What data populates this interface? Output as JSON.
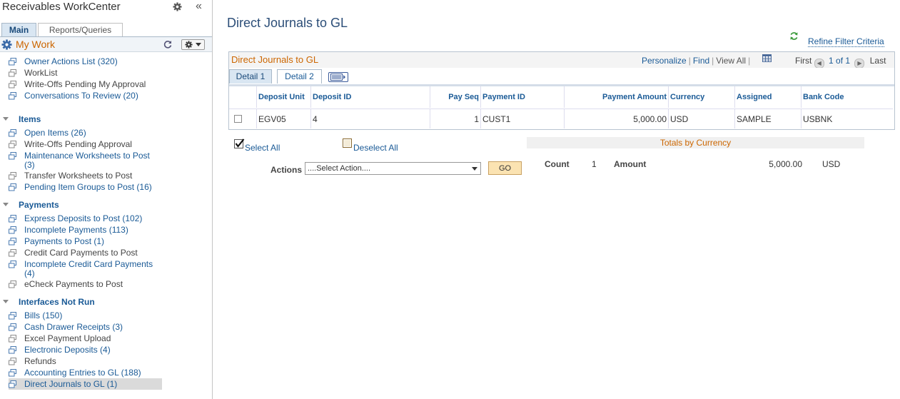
{
  "sidebar": {
    "title": "Receivables WorkCenter",
    "collapse_glyph": "«",
    "tabs": [
      "Main",
      "Reports/Queries"
    ],
    "mywork": "My Work",
    "sections": [
      {
        "name": "Items"
      },
      {
        "name": "Payments"
      },
      {
        "name": "Interfaces Not Run"
      }
    ],
    "mywork_items": [
      {
        "label": "Owner Actions List (320)",
        "link": true
      },
      {
        "label": "WorkList",
        "link": false
      },
      {
        "label": "Write-Offs Pending My Approval",
        "link": false
      },
      {
        "label": "Conversations To Review (20)",
        "link": true
      }
    ],
    "items_items": [
      {
        "label": "Open Items (26)",
        "link": true
      },
      {
        "label": "Write-Offs Pending Approval",
        "link": false
      },
      {
        "label": "Maintenance Worksheets to Post (3)",
        "link": true
      },
      {
        "label": "Transfer Worksheets to Post",
        "link": false
      },
      {
        "label": "Pending Item Groups to Post (16)",
        "link": true
      }
    ],
    "payments_items": [
      {
        "label": "Express Deposits to Post (102)",
        "link": true
      },
      {
        "label": "Incomplete Payments (113)",
        "link": true
      },
      {
        "label": "Payments to Post (1)",
        "link": true
      },
      {
        "label": "Credit Card Payments to Post",
        "link": false
      },
      {
        "label": "Incomplete Credit Card Payments (4)",
        "link": true
      },
      {
        "label": "eCheck Payments to Post",
        "link": false
      }
    ],
    "interfaces_items": [
      {
        "label": "Bills (150)",
        "link": true
      },
      {
        "label": "Cash Drawer Receipts (3)",
        "link": true
      },
      {
        "label": "Excel Payment Upload",
        "link": false
      },
      {
        "label": "Electronic Deposits (4)",
        "link": true
      },
      {
        "label": "Refunds",
        "link": false
      },
      {
        "label": "Accounting Entries to GL (188)",
        "link": true
      },
      {
        "label": "Direct Journals to GL (1)",
        "link": true,
        "selected": true
      }
    ]
  },
  "main": {
    "title": "Direct Journals to GL",
    "refine": "Refine Filter Criteria",
    "grid": {
      "title": "Direct Journals to GL",
      "personalize": "Personalize",
      "find": "Find",
      "view_all": "View All",
      "first": "First",
      "pager": "1 of 1",
      "last": "Last",
      "tabs": [
        "Detail 1",
        "Detail 2"
      ],
      "columns": [
        "Deposit Unit",
        "Deposit ID",
        "Pay Seq",
        "Payment ID",
        "Payment Amount",
        "Currency",
        "Assigned",
        "Bank Code"
      ],
      "row": {
        "deposit_unit": "EGV05",
        "deposit_id": "4",
        "pay_seq": "1",
        "payment_id": "CUST1",
        "payment_amount": "5,000.00",
        "currency": "USD",
        "assigned": "SAMPLE",
        "bank_code": "USBNK"
      }
    },
    "select_all": "Select All",
    "deselect_all": "Deselect All",
    "actions_label": "Actions",
    "actions_selected": "....Select Action....",
    "go": "GO",
    "totals": {
      "title": "Totals by Currency",
      "count_label": "Count",
      "count": "1",
      "amount_label": "Amount",
      "amount": "5,000.00",
      "currency": "USD"
    }
  },
  "colors": {
    "accent_orange": "#cc6600",
    "link_blue": "#1a5a96",
    "title_blue": "#2c4e78"
  }
}
